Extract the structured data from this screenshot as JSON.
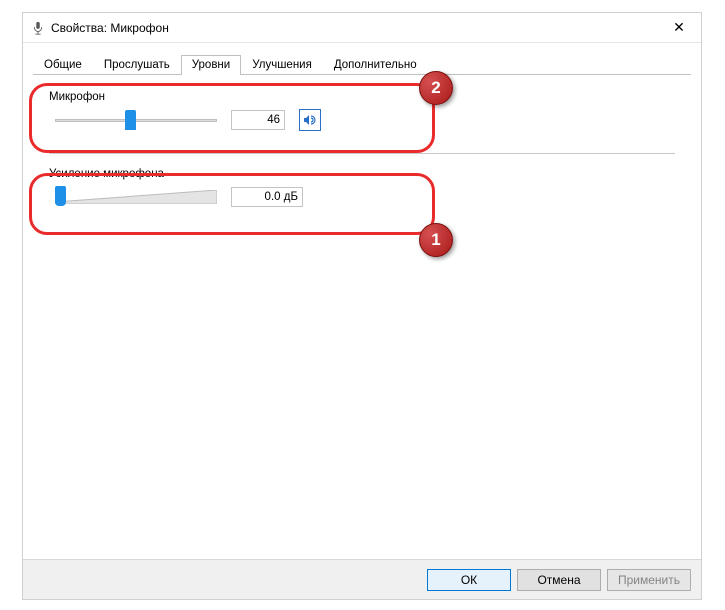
{
  "window": {
    "title": "Свойства: Микрофон"
  },
  "tabs": {
    "t0": "Общие",
    "t1": "Прослушать",
    "t2": "Уровни",
    "t3": "Улучшения",
    "t4": "Дополнительно",
    "active": 2
  },
  "groups": {
    "volume": {
      "label": "Микрофон",
      "value": "46",
      "slider_percent": 46
    },
    "gain": {
      "label": "Усиление микрофона",
      "value": "0.0 дБ",
      "slider_percent": 0
    }
  },
  "badges": {
    "b1": "1",
    "b2": "2"
  },
  "buttons": {
    "ok": "ОК",
    "cancel": "Отмена",
    "apply": "Применить"
  },
  "icons": {
    "close": "✕"
  }
}
